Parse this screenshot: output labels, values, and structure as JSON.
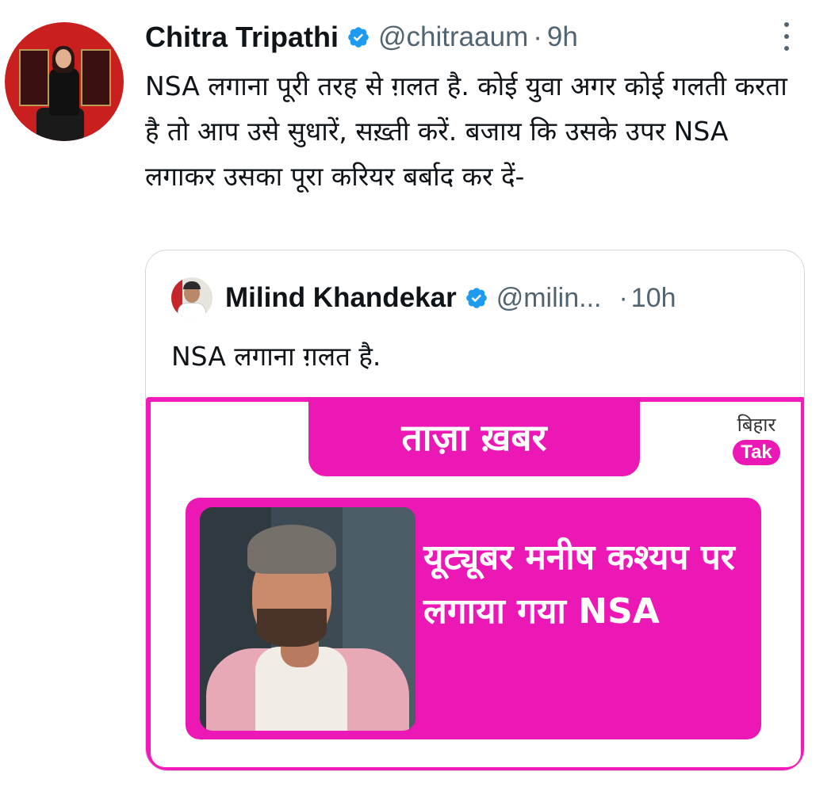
{
  "tweet": {
    "author_name": "Chitra Tripathi",
    "author_handle": "@chitraaum",
    "separator": "·",
    "time": "9h",
    "text": "NSA लगाना पूरी तरह से ग़लत है. कोई युवा अगर कोई गलती करता है तो आप उसे सुधारें, सख़्ती करें. बजाय कि उसके उपर NSA लगाकर उसका पूरा करियर बर्बाद कर दें-"
  },
  "quoted": {
    "author_name": "Milind Khandekar",
    "author_handle": "@milin...",
    "separator": "·",
    "time": "10h",
    "text": "NSA लगाना ग़लत है.",
    "media": {
      "banner": "ताज़ा ख़बर",
      "logo_top": "बिहार",
      "logo_bottom": "Tak",
      "headline": "यूट्यूबर मनीष कश्यप पर लगाया गया NSA"
    }
  },
  "icons": {
    "verified": "verified-badge-icon",
    "more": "more-options-icon"
  },
  "colors": {
    "verified_blue": "#1d9bf0",
    "secondary_text": "#536471",
    "brand_pink": "#ec18b6"
  }
}
